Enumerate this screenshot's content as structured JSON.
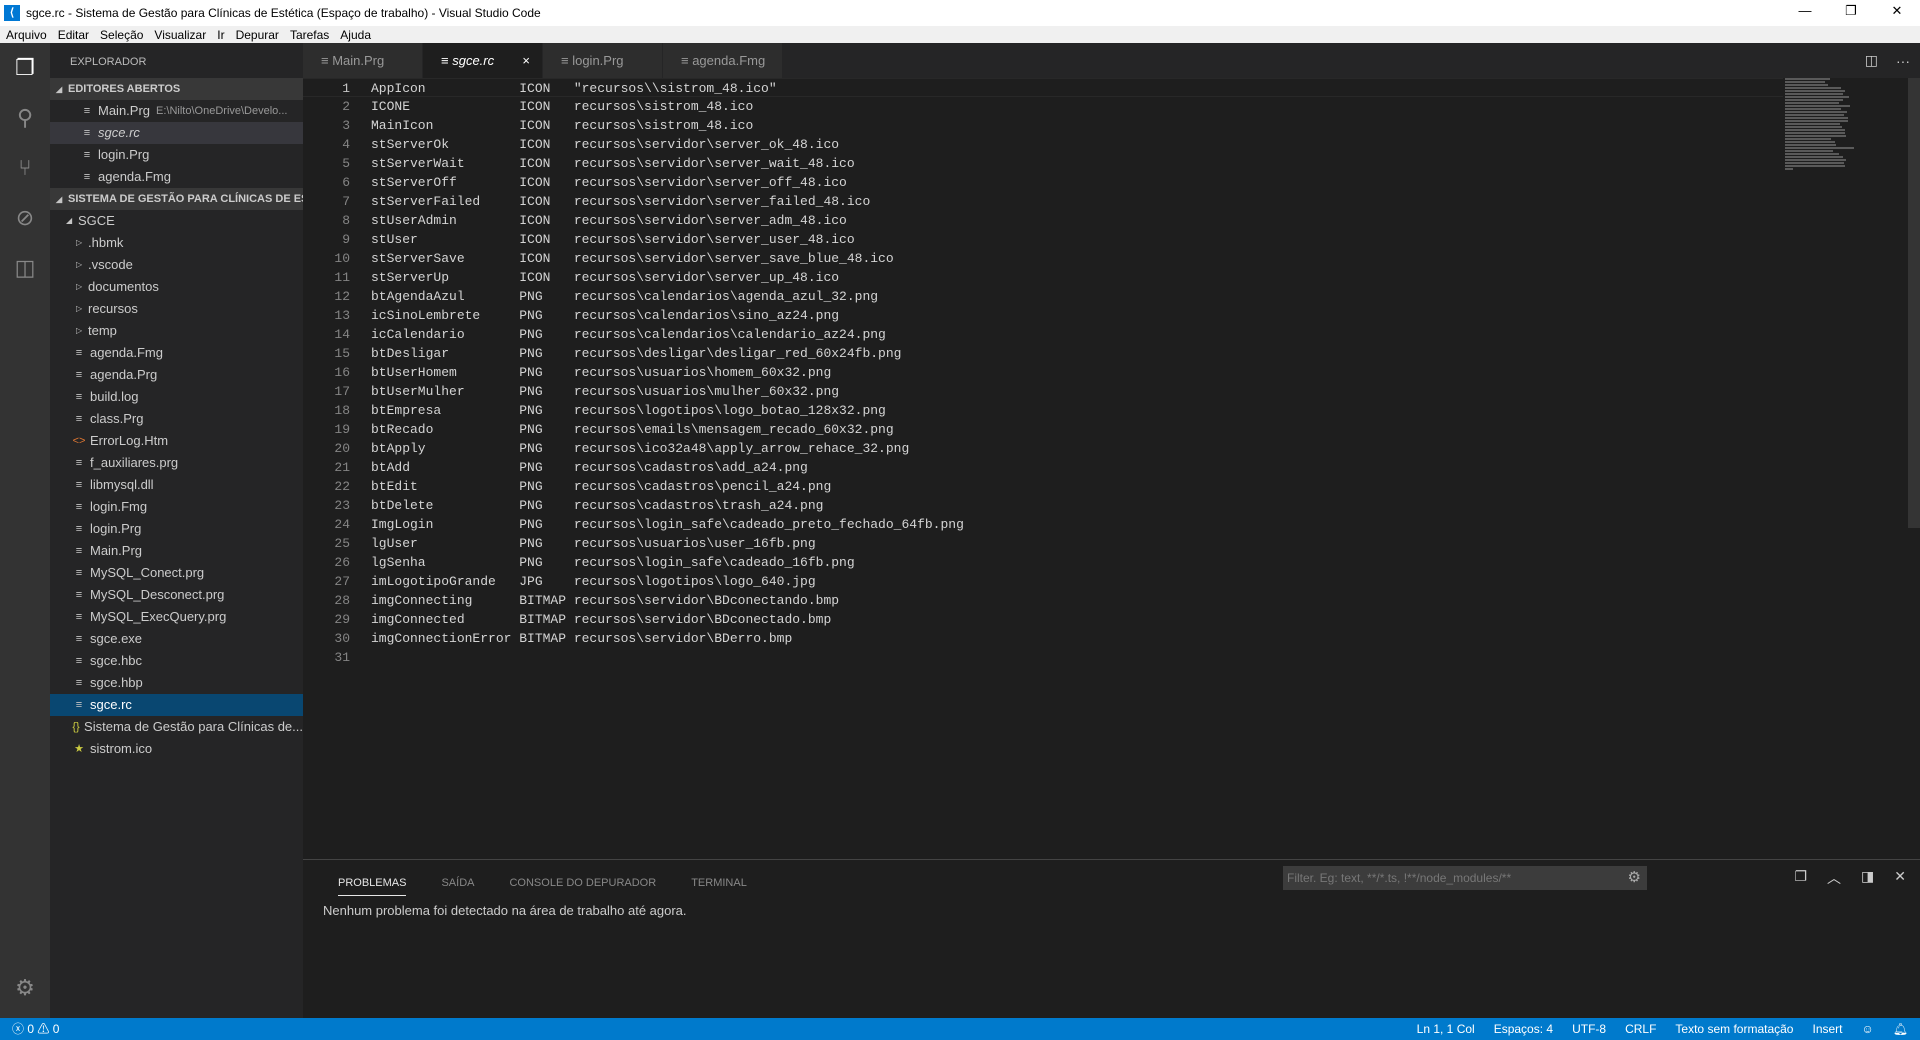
{
  "window": {
    "title": "sgce.rc - Sistema de Gestão para Clínicas de Estética (Espaço de trabalho) - Visual Studio Code",
    "logo": "VS Code"
  },
  "menu": [
    "Arquivo",
    "Editar",
    "Seleção",
    "Visualizar",
    "Ir",
    "Depurar",
    "Tarefas",
    "Ajuda"
  ],
  "sidebar": {
    "title": "EXPLORADOR",
    "open_editors_header": "EDITORES ABERTOS",
    "open_editors": [
      {
        "label": "Main.Prg",
        "desc": "E:\\Nilto\\OneDrive\\Develo..."
      },
      {
        "label": "sgce.rc",
        "desc": ""
      },
      {
        "label": "login.Prg",
        "desc": ""
      },
      {
        "label": "agenda.Fmg",
        "desc": ""
      }
    ],
    "workspace_header": "SISTEMA DE GESTÃO PARA CLÍNICAS DE ES...",
    "root": "SGCE",
    "folders": [
      ".hbmk",
      ".vscode",
      "documentos",
      "recursos",
      "temp"
    ],
    "files": [
      {
        "label": "agenda.Fmg",
        "icon": "file-lines-icon"
      },
      {
        "label": "agenda.Prg",
        "icon": "file-lines-icon"
      },
      {
        "label": "build.log",
        "icon": "file-lines-icon"
      },
      {
        "label": "class.Prg",
        "icon": "file-lines-icon"
      },
      {
        "label": "ErrorLog.Htm",
        "icon": "html-icon"
      },
      {
        "label": "f_auxiliares.prg",
        "icon": "file-lines-icon"
      },
      {
        "label": "libmysql.dll",
        "icon": "file-lines-icon"
      },
      {
        "label": "login.Fmg",
        "icon": "file-lines-icon"
      },
      {
        "label": "login.Prg",
        "icon": "file-lines-icon"
      },
      {
        "label": "Main.Prg",
        "icon": "file-lines-icon"
      },
      {
        "label": "MySQL_Conect.prg",
        "icon": "file-lines-icon"
      },
      {
        "label": "MySQL_Desconect.prg",
        "icon": "file-lines-icon"
      },
      {
        "label": "MySQL_ExecQuery.prg",
        "icon": "file-lines-icon"
      },
      {
        "label": "sgce.exe",
        "icon": "file-lines-icon"
      },
      {
        "label": "sgce.hbc",
        "icon": "file-lines-icon"
      },
      {
        "label": "sgce.hbp",
        "icon": "file-lines-icon"
      },
      {
        "label": "sgce.rc",
        "icon": "file-lines-icon"
      },
      {
        "label": "Sistema de Gestão para Clínicas de...",
        "icon": "json-braces-icon"
      },
      {
        "label": "sistrom.ico",
        "icon": "star-icon"
      }
    ]
  },
  "tabs": [
    {
      "label": "Main.Prg"
    },
    {
      "label": "sgce.rc",
      "close": "×"
    },
    {
      "label": "login.Prg"
    },
    {
      "label": "agenda.Fmg"
    }
  ],
  "editor": {
    "lines": [
      [
        "AppIcon",
        "ICON",
        "\"recursos\\\\sistrom_48.ico\""
      ],
      [
        "ICONE",
        "ICON",
        "recursos\\sistrom_48.ico"
      ],
      [
        "MainIcon",
        "ICON",
        "recursos\\sistrom_48.ico"
      ],
      [
        "stServerOk",
        "ICON",
        "recursos\\servidor\\server_ok_48.ico"
      ],
      [
        "stServerWait",
        "ICON",
        "recursos\\servidor\\server_wait_48.ico"
      ],
      [
        "stServerOff",
        "ICON",
        "recursos\\servidor\\server_off_48.ico"
      ],
      [
        "stServerFailed",
        "ICON",
        "recursos\\servidor\\server_failed_48.ico"
      ],
      [
        "stUserAdmin",
        "ICON",
        "recursos\\servidor\\server_adm_48.ico"
      ],
      [
        "stUser",
        "ICON",
        "recursos\\servidor\\server_user_48.ico"
      ],
      [
        "stServerSave",
        "ICON",
        "recursos\\servidor\\server_save_blue_48.ico"
      ],
      [
        "stServerUp",
        "ICON",
        "recursos\\servidor\\server_up_48.ico"
      ],
      [
        "btAgendaAzul",
        "PNG",
        "recursos\\calendarios\\agenda_azul_32.png"
      ],
      [
        "icSinoLembrete",
        "PNG",
        "recursos\\calendarios\\sino_az24.png"
      ],
      [
        "icCalendario",
        "PNG",
        "recursos\\calendarios\\calendario_az24.png"
      ],
      [
        "btDesligar",
        "PNG",
        "recursos\\desligar\\desligar_red_60x24fb.png"
      ],
      [
        "btUserHomem",
        "PNG",
        "recursos\\usuarios\\homem_60x32.png"
      ],
      [
        "btUserMulher",
        "PNG",
        "recursos\\usuarios\\mulher_60x32.png"
      ],
      [
        "btEmpresa",
        "PNG",
        "recursos\\logotipos\\logo_botao_128x32.png"
      ],
      [
        "btRecado",
        "PNG",
        "recursos\\emails\\mensagem_recado_60x32.png"
      ],
      [
        "btApply",
        "PNG",
        "recursos\\ico32a48\\apply_arrow_rehace_32.png"
      ],
      [
        "btAdd",
        "PNG",
        "recursos\\cadastros\\add_a24.png"
      ],
      [
        "btEdit",
        "PNG",
        "recursos\\cadastros\\pencil_a24.png"
      ],
      [
        "btDelete",
        "PNG",
        "recursos\\cadastros\\trash_a24.png"
      ],
      [
        "ImgLogin",
        "PNG",
        "recursos\\login_safe\\cadeado_preto_fechado_64fb.png"
      ],
      [
        "lgUser",
        "PNG",
        "recursos\\usuarios\\user_16fb.png"
      ],
      [
        "lgSenha",
        "PNG",
        "recursos\\login_safe\\cadeado_16fb.png"
      ],
      [
        "imLogotipoGrande",
        "JPG",
        "recursos\\logotipos\\logo_640.jpg"
      ],
      [
        "imgConnecting",
        "BITMAP",
        "recursos\\servidor\\BDconectando.bmp"
      ],
      [
        "imgConnected",
        "BITMAP",
        "recursos\\servidor\\BDconectado.bmp"
      ],
      [
        "imgConnectionError",
        "BITMAP",
        "recursos\\servidor\\BDerro.bmp"
      ],
      [
        "",
        "",
        ""
      ]
    ]
  },
  "panel": {
    "tabs": [
      "PROBLEMAS",
      "SAÍDA",
      "CONSOLE DO DEPURADOR",
      "TERMINAL"
    ],
    "message": "Nenhum problema foi detectado na área de trabalho até agora.",
    "filter_placeholder": "Filter. Eg: text, **/*.ts, !**/node_modules/**"
  },
  "status": {
    "errors": "0",
    "warnings": "0",
    "position": "Ln 1, 1 Col",
    "spaces": "Espaços: 4",
    "encoding": "UTF-8",
    "eol": "CRLF",
    "language": "Texto sem formatação",
    "mode": "Insert"
  },
  "colors": {
    "statusbar": "#007acc",
    "selection": "#094771"
  }
}
